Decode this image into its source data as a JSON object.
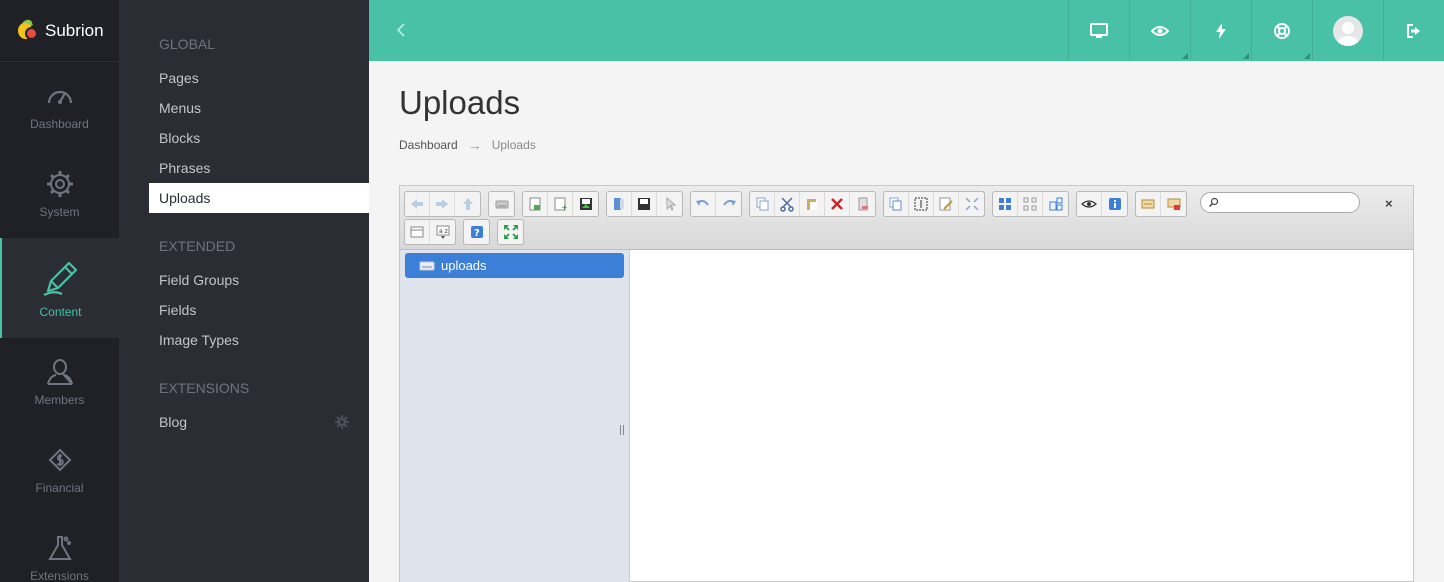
{
  "brand": {
    "name": "Subrion"
  },
  "rail": {
    "items": [
      {
        "label": "Dashboard",
        "icon": "gauge-icon"
      },
      {
        "label": "System",
        "icon": "gear-icon"
      },
      {
        "label": "Content",
        "icon": "pencil-icon",
        "active": true
      },
      {
        "label": "Members",
        "icon": "user-icon"
      },
      {
        "label": "Financial",
        "icon": "money-icon"
      },
      {
        "label": "Extensions",
        "icon": "flask-icon"
      }
    ]
  },
  "submenu": {
    "sections": [
      {
        "title": "GLOBAL",
        "items": [
          "Pages",
          "Menus",
          "Blocks",
          "Phrases",
          "Uploads"
        ]
      },
      {
        "title": "EXTENDED",
        "items": [
          "Field Groups",
          "Fields",
          "Image Types"
        ]
      },
      {
        "title": "EXTENSIONS",
        "items": [
          "Blog"
        ]
      }
    ],
    "active_item": "Uploads"
  },
  "topbar": {
    "icons": [
      "chevron-left-icon",
      "desktop-icon",
      "eye-icon",
      "bolt-icon",
      "lifebuoy-icon",
      "avatar",
      "sign-out-icon"
    ]
  },
  "page": {
    "title": "Uploads",
    "breadcrumb": {
      "home": "Dashboard",
      "separator": "→",
      "current": "Uploads"
    }
  },
  "file_manager": {
    "search_placeholder": "",
    "close_label": "×",
    "tree_root": "uploads"
  },
  "colors": {
    "accent": "#48c1a7",
    "rail_bg": "#1f2126",
    "submenu_bg": "#2a2d33",
    "selection": "#3b7fd9"
  }
}
